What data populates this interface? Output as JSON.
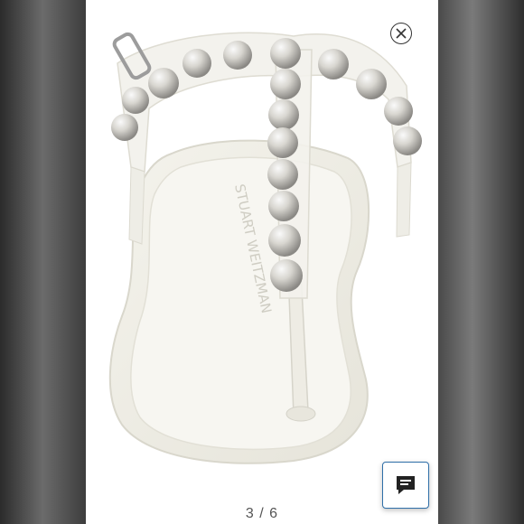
{
  "viewer": {
    "counter": "3 / 6",
    "brand_text": "STUART WEITZMAN"
  },
  "icons": {
    "close": "close-icon",
    "chat": "chat-icon"
  },
  "colors": {
    "panel_bg": "#ffffff",
    "chat_border": "#2f6fa8",
    "pearl": "#d8d6d0"
  }
}
